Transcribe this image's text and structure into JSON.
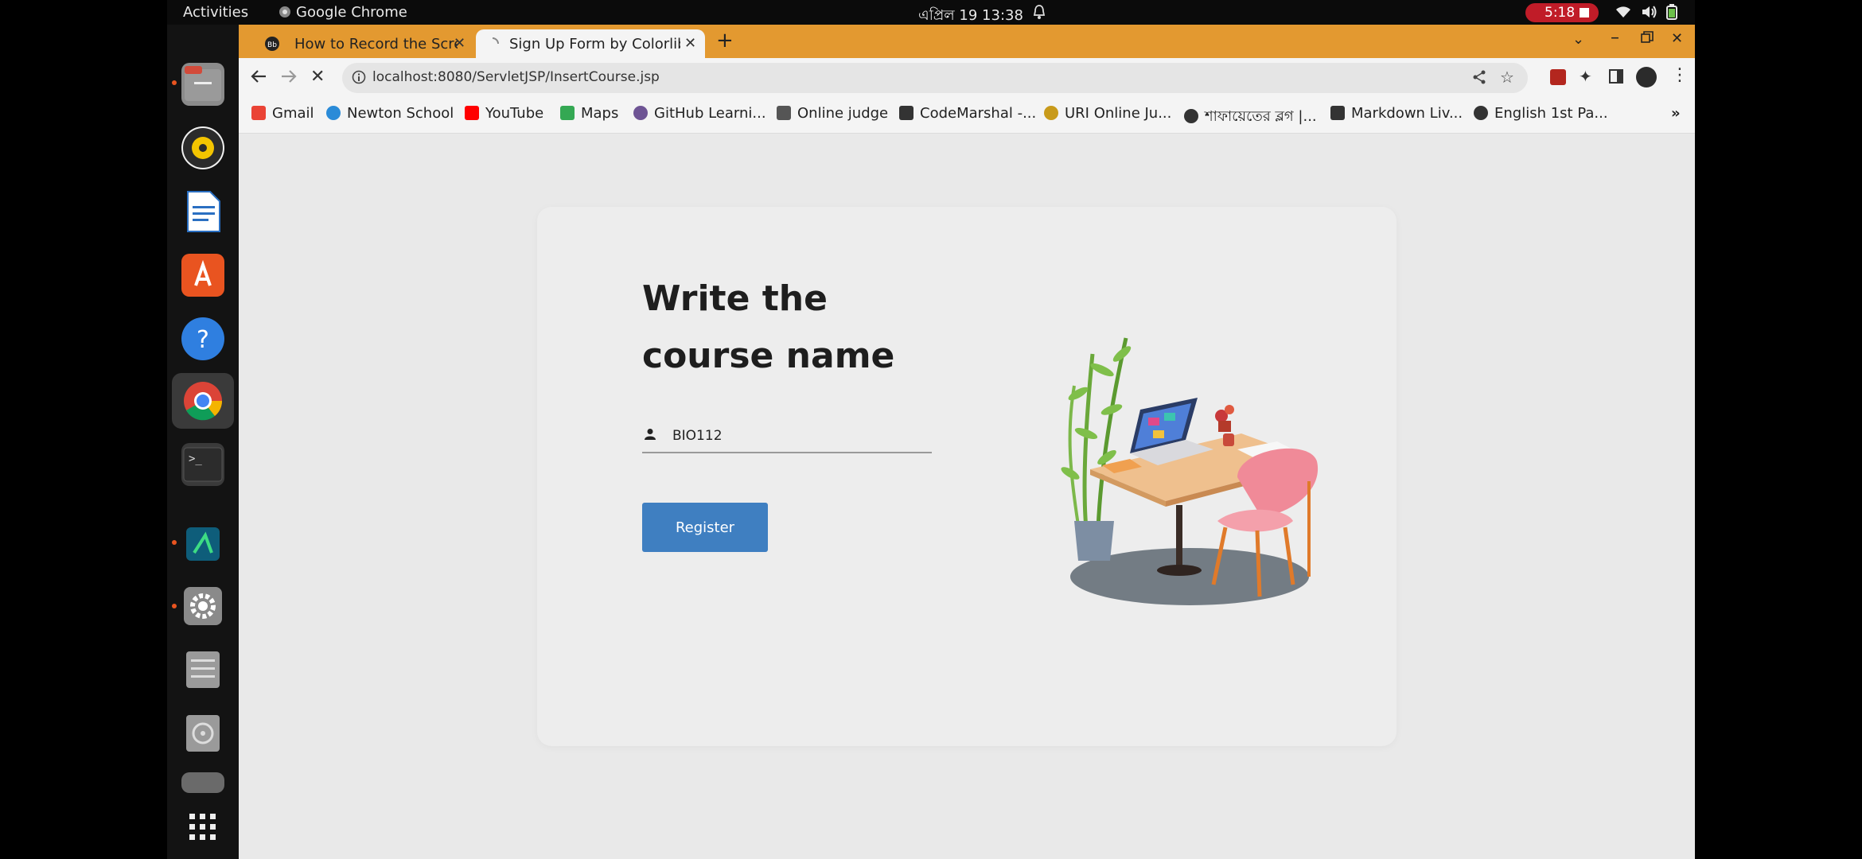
{
  "system_bar": {
    "activities": "Activities",
    "active_app": "Google Chrome",
    "clock": "এপ্রিল 19  13:38",
    "recording_time": "5:18"
  },
  "dock": {
    "items": [
      "files-icon",
      "rhythmbox-icon",
      "writer-icon",
      "app-center-icon",
      "help-icon",
      "chrome-icon",
      "terminal-icon",
      "android-studio-icon",
      "settings-icon",
      "file-list-icon",
      "disc-icon",
      "trash-icon",
      "app-grid-icon"
    ]
  },
  "browser": {
    "tabs": [
      {
        "label": "How to Record the Screen"
      },
      {
        "label": "Sign Up Form by Colorlib"
      }
    ],
    "url": "localhost:8080/ServletJSP/InsertCourse.jsp",
    "bookmarks": [
      {
        "label": "Gmail",
        "color": "#ea4335"
      },
      {
        "label": "Newton School",
        "color": "#2a8bd8"
      },
      {
        "label": "YouTube",
        "color": "#ff0000"
      },
      {
        "label": "Maps",
        "color": "#34a853"
      },
      {
        "label": "GitHub Learni...",
        "color": "#6e5494"
      },
      {
        "label": "Online judge",
        "color": "#555555"
      },
      {
        "label": "CodeMarshal -...",
        "color": "#333333"
      },
      {
        "label": "URI Online Ju...",
        "color": "#c89a1a"
      },
      {
        "label": "শাফায়েতের ব্লগ |...",
        "color": "#333333"
      },
      {
        "label": "Markdown Liv...",
        "color": "#333333"
      },
      {
        "label": "English 1st Pa...",
        "color": "#333333"
      }
    ],
    "overflow": "»"
  },
  "form": {
    "heading_line1": "Write the",
    "heading_line2": "course name",
    "course_value": "BIO112",
    "register_label": "Register"
  }
}
